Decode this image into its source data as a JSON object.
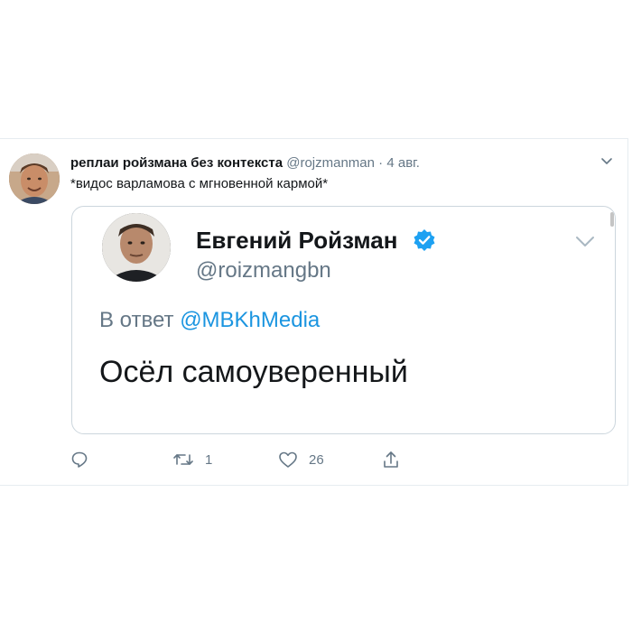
{
  "tweet": {
    "author_name": "реплаи ройзмана без контекста",
    "handle": "@rojzmanman",
    "separator": "·",
    "date": "4 авг.",
    "text": "*видос варламова с мгновенной кармой*",
    "avatar_icon": "user-avatar-photo",
    "menu_icon": "chevron-down-icon"
  },
  "quoted": {
    "author_name": "Евгений Ройзман",
    "verified_icon": "verified-badge-icon",
    "handle": "@roizmangbn",
    "reply_prefix": "В ответ",
    "reply_mention": "@MBKhMedia",
    "text": "Осёл самоуверенный",
    "avatar_icon": "user-avatar-photo",
    "menu_icon": "chevron-down-icon"
  },
  "actions": {
    "reply_icon": "reply-icon",
    "reply_count": "",
    "retweet_icon": "retweet-icon",
    "retweet_count": "1",
    "like_icon": "heart-icon",
    "like_count": "26",
    "share_icon": "share-icon"
  },
  "colors": {
    "text_primary": "#14171a",
    "text_secondary": "#657786",
    "link": "#1b95e0",
    "verified": "#1da1f2",
    "border": "#ccd6dd"
  }
}
